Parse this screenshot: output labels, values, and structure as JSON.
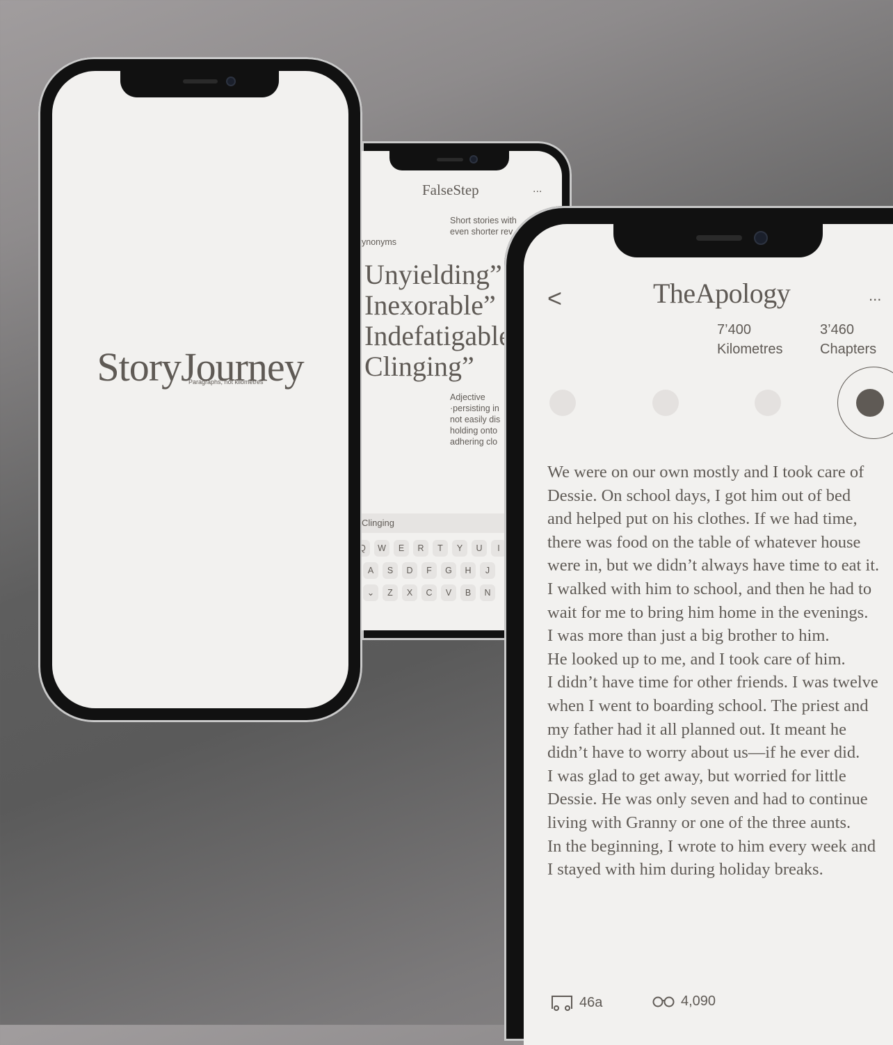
{
  "splash": {
    "logo": "StoryJourney",
    "tagline": "Paragraphs, not kilometres"
  },
  "editor": {
    "title": "FalseStep",
    "more": "...",
    "tagline_line1": "Short stories with",
    "tagline_line2": "even shorter rev",
    "synonyms_label": "ynonyms",
    "words": [
      "Unyielding”",
      "Inexorable”",
      "Indefatigable",
      "Clinging”"
    ],
    "definition_lines": [
      "Adjective",
      "·persisting in",
      "not easily dis",
      "holding onto",
      "adhering clo"
    ],
    "keyboard": {
      "suggestion": "Clinging",
      "row1": [
        "Q",
        "W",
        "E",
        "R",
        "T",
        "Y",
        "U",
        "I"
      ],
      "row2": [
        "A",
        "S",
        "D",
        "F",
        "G",
        "H",
        "J"
      ],
      "row3": [
        "⌄",
        "Z",
        "X",
        "C",
        "V",
        "B",
        "N"
      ]
    }
  },
  "reader": {
    "back": "<",
    "title": "TheApology",
    "more": "...",
    "stats": [
      {
        "value": "7’400",
        "label": "Kilometres"
      },
      {
        "value": "3’460",
        "label": "Chapters"
      }
    ],
    "progress": {
      "total_steps": 4,
      "active_step": 4
    },
    "story_lines": [
      "We were on our own mostly and I took care of",
      "Dessie. On school days, I got him out of bed",
      "and helped put on his clothes. If we had time,",
      "there was food on the table of whatever house",
      "were in, but we didn’t always have time to eat it.",
      "I walked with him to school, and then he had to",
      "wait for me to bring him home in the evenings.",
      "I was more than just a big brother to him.",
      "He looked up to me, and I took care of him.",
      "I didn’t have time for other friends. I was twelve",
      "when I went to boarding school. The priest and",
      "my father had it all planned out. It meant he",
      "didn’t have to worry about us—if he ever did.",
      "I was glad to get away, but worried for little",
      "Dessie. He was only seven and had to continue",
      "living with Granny or one of the three aunts.",
      "In the beginning, I wrote to him every week and",
      "I stayed with him during holiday breaks."
    ],
    "footer": {
      "transit_icon": "train-icon",
      "transit_value": "46a",
      "reading_icon": "glasses-icon",
      "reading_value": "4,090"
    }
  }
}
